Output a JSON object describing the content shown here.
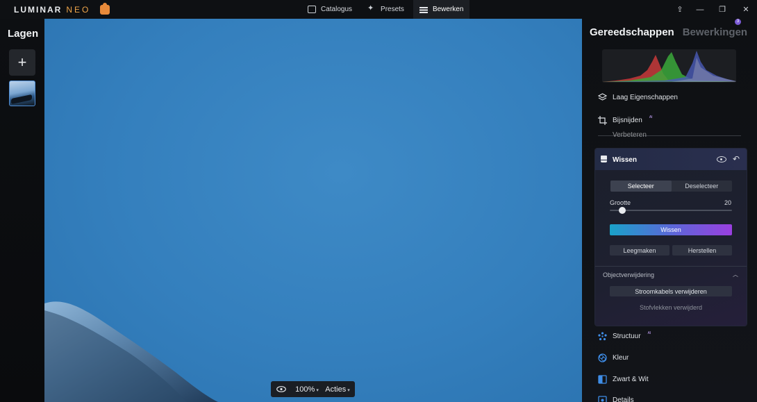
{
  "app": {
    "logo_main": "LUMINAR",
    "logo_sub": "NEO"
  },
  "nav": {
    "items": [
      {
        "label": "Catalogus",
        "icon": "folder-icon"
      },
      {
        "label": "Presets",
        "icon": "presets-icon"
      },
      {
        "label": "Bewerken",
        "icon": "sliders-icon",
        "active": true
      }
    ]
  },
  "window_controls": {
    "share": "⇪",
    "minimize": "—",
    "restore": "❐",
    "close": "✕"
  },
  "layers": {
    "title": "Lagen",
    "add_label": "+"
  },
  "bottom_bar": {
    "zoom": "100%",
    "actions": "Acties"
  },
  "right_panel": {
    "tab_tools": "Gereedschappen",
    "tab_edits": "Bewerkingen",
    "edits_badge": "3",
    "tools": [
      {
        "label": "Laag Eigenschappen",
        "icon": "layers-icon"
      },
      {
        "label": "Bijsnijden",
        "icon": "crop-icon",
        "ai": "AI"
      },
      {
        "label": "Verbeteren",
        "icon": "enhance-icon"
      }
    ],
    "wissen": {
      "title": "Wissen",
      "select": "Selecteer",
      "deselect": "Deselecteer",
      "size_label": "Grootte",
      "size_value": "20",
      "size_fraction": 0.08,
      "erase_button": "Wissen",
      "clear_button": "Leegmaken",
      "restore_button": "Herstellen",
      "object_removal": "Objectverwijdering",
      "powerlines_button": "Stroomkabels verwijderen",
      "dust_status": "Stofvlekken verwijderd"
    },
    "tools_below": [
      {
        "label": "Structuur",
        "icon": "structure-icon",
        "ai": "AI"
      },
      {
        "label": "Kleur",
        "icon": "color-icon"
      },
      {
        "label": "Zwart & Wit",
        "icon": "black-white-icon"
      },
      {
        "label": "Details",
        "icon": "details-icon"
      }
    ]
  },
  "colors": {
    "accent_start": "#1aa2c9",
    "accent_end": "#9a3fe0",
    "canvas_sky": "#347fbd"
  }
}
